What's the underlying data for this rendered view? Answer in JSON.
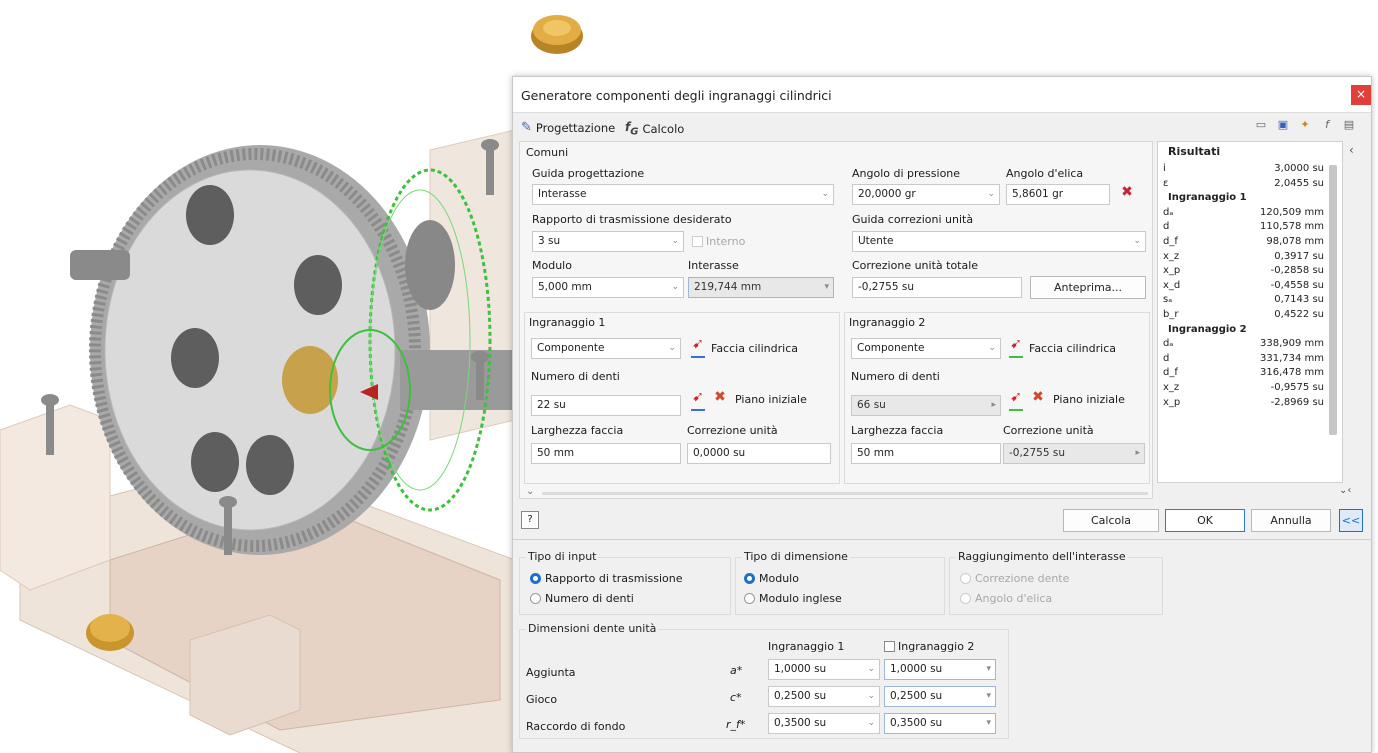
{
  "dialog": {
    "title": "Generatore componenti degli ingranaggi cilindrici",
    "close_label": "×",
    "tabs": [
      {
        "label": "Progettazione",
        "icon": "design-icon"
      },
      {
        "label": "Calcolo",
        "icon": "fx-icon"
      }
    ]
  },
  "comuni": {
    "section_label": "Comuni",
    "guida_label": "Guida progettazione",
    "guida_value": "Interasse",
    "rapporto_label": "Rapporto di trasmissione desiderato",
    "rapporto_value": "3 su",
    "interno_label": "Interno",
    "modulo_label": "Modulo",
    "modulo_value": "5,000 mm",
    "interasse_label": "Interasse",
    "interasse_value": "219,744 mm",
    "pressione_label": "Angolo di pressione",
    "pressione_value": "20,0000 gr",
    "elica_label": "Angolo d'elica",
    "elica_value": "5,8601 gr",
    "correzioni_label": "Guida correzioni unità",
    "correzioni_value": "Utente",
    "correzione_totale_label": "Correzione unità totale",
    "correzione_totale_value": "-0,2755 su",
    "anteprima_label": "Anteprima..."
  },
  "ingranaggio1": {
    "title": "Ingranaggio 1",
    "tipo_value": "Componente",
    "faccia_label": "Faccia cilindrica",
    "denti_label": "Numero di denti",
    "denti_value": "22 su",
    "piano_label": "Piano iniziale",
    "larghezza_label": "Larghezza faccia",
    "larghezza_value": "50 mm",
    "correzione_label": "Correzione unità",
    "correzione_value": "0,0000 su"
  },
  "ingranaggio2": {
    "title": "Ingranaggio 2",
    "tipo_value": "Componente",
    "faccia_label": "Faccia cilindrica",
    "denti_label": "Numero di denti",
    "denti_value": "66 su",
    "piano_label": "Piano iniziale",
    "larghezza_label": "Larghezza faccia",
    "larghezza_value": "50 mm",
    "correzione_label": "Correzione unità",
    "correzione_value": "-0,2755 su"
  },
  "results": {
    "title": "Risultati",
    "rows": [
      {
        "k": "i",
        "v": "3,0000 su"
      },
      {
        "k": "ε",
        "v": "2,0455 su"
      },
      {
        "k": "Ingranaggio 1",
        "v": "",
        "head": true
      },
      {
        "k": "dₐ",
        "v": "120,509 mm"
      },
      {
        "k": "d",
        "v": "110,578 mm"
      },
      {
        "k": "d_f",
        "v": "98,078 mm"
      },
      {
        "k": "x_z",
        "v": "0,3917 su"
      },
      {
        "k": "x_p",
        "v": "-0,2858 su"
      },
      {
        "k": "x_d",
        "v": "-0,4558 su"
      },
      {
        "k": "sₐ",
        "v": "0,7143 su"
      },
      {
        "k": "b_r",
        "v": "0,4522 su"
      },
      {
        "k": "Ingranaggio 2",
        "v": "",
        "head": true
      },
      {
        "k": "dₐ",
        "v": "338,909 mm"
      },
      {
        "k": "d",
        "v": "331,734 mm"
      },
      {
        "k": "d_f",
        "v": "316,478 mm"
      },
      {
        "k": "x_z",
        "v": "-0,9575 su"
      },
      {
        "k": "x_p",
        "v": "-2,8969 su"
      }
    ]
  },
  "buttons": {
    "help": "?",
    "calcola": "Calcola",
    "ok": "OK",
    "annulla": "Annulla",
    "collapse": "<<"
  },
  "tipo_input": {
    "title": "Tipo di input",
    "opt1": "Rapporto di trasmissione",
    "opt2": "Numero di denti"
  },
  "tipo_dimensione": {
    "title": "Tipo di dimensione",
    "opt1": "Modulo",
    "opt2": "Modulo inglese"
  },
  "raggiungimento": {
    "title": "Raggiungimento dell'interasse",
    "opt1": "Correzione dente",
    "opt2": "Angolo d'elica"
  },
  "dimensioni": {
    "title": "Dimensioni dente unità",
    "col1": "Ingranaggio 1",
    "col2": "Ingranaggio 2",
    "rows": [
      {
        "label": "Aggiunta",
        "sym": "a*",
        "v1": "1,0000 su",
        "v2": "1,0000 su"
      },
      {
        "label": "Gioco",
        "sym": "c*",
        "v1": "0,2500 su",
        "v2": "0,2500 su"
      },
      {
        "label": "Raccordo di fondo",
        "sym": "r_f*",
        "v1": "0,3500 su",
        "v2": "0,3500 su"
      }
    ]
  },
  "colors": {
    "accent": "#1e6fc9",
    "close": "#e0403a",
    "gear_green": "#3cc13c",
    "brass": "#c9962e"
  }
}
